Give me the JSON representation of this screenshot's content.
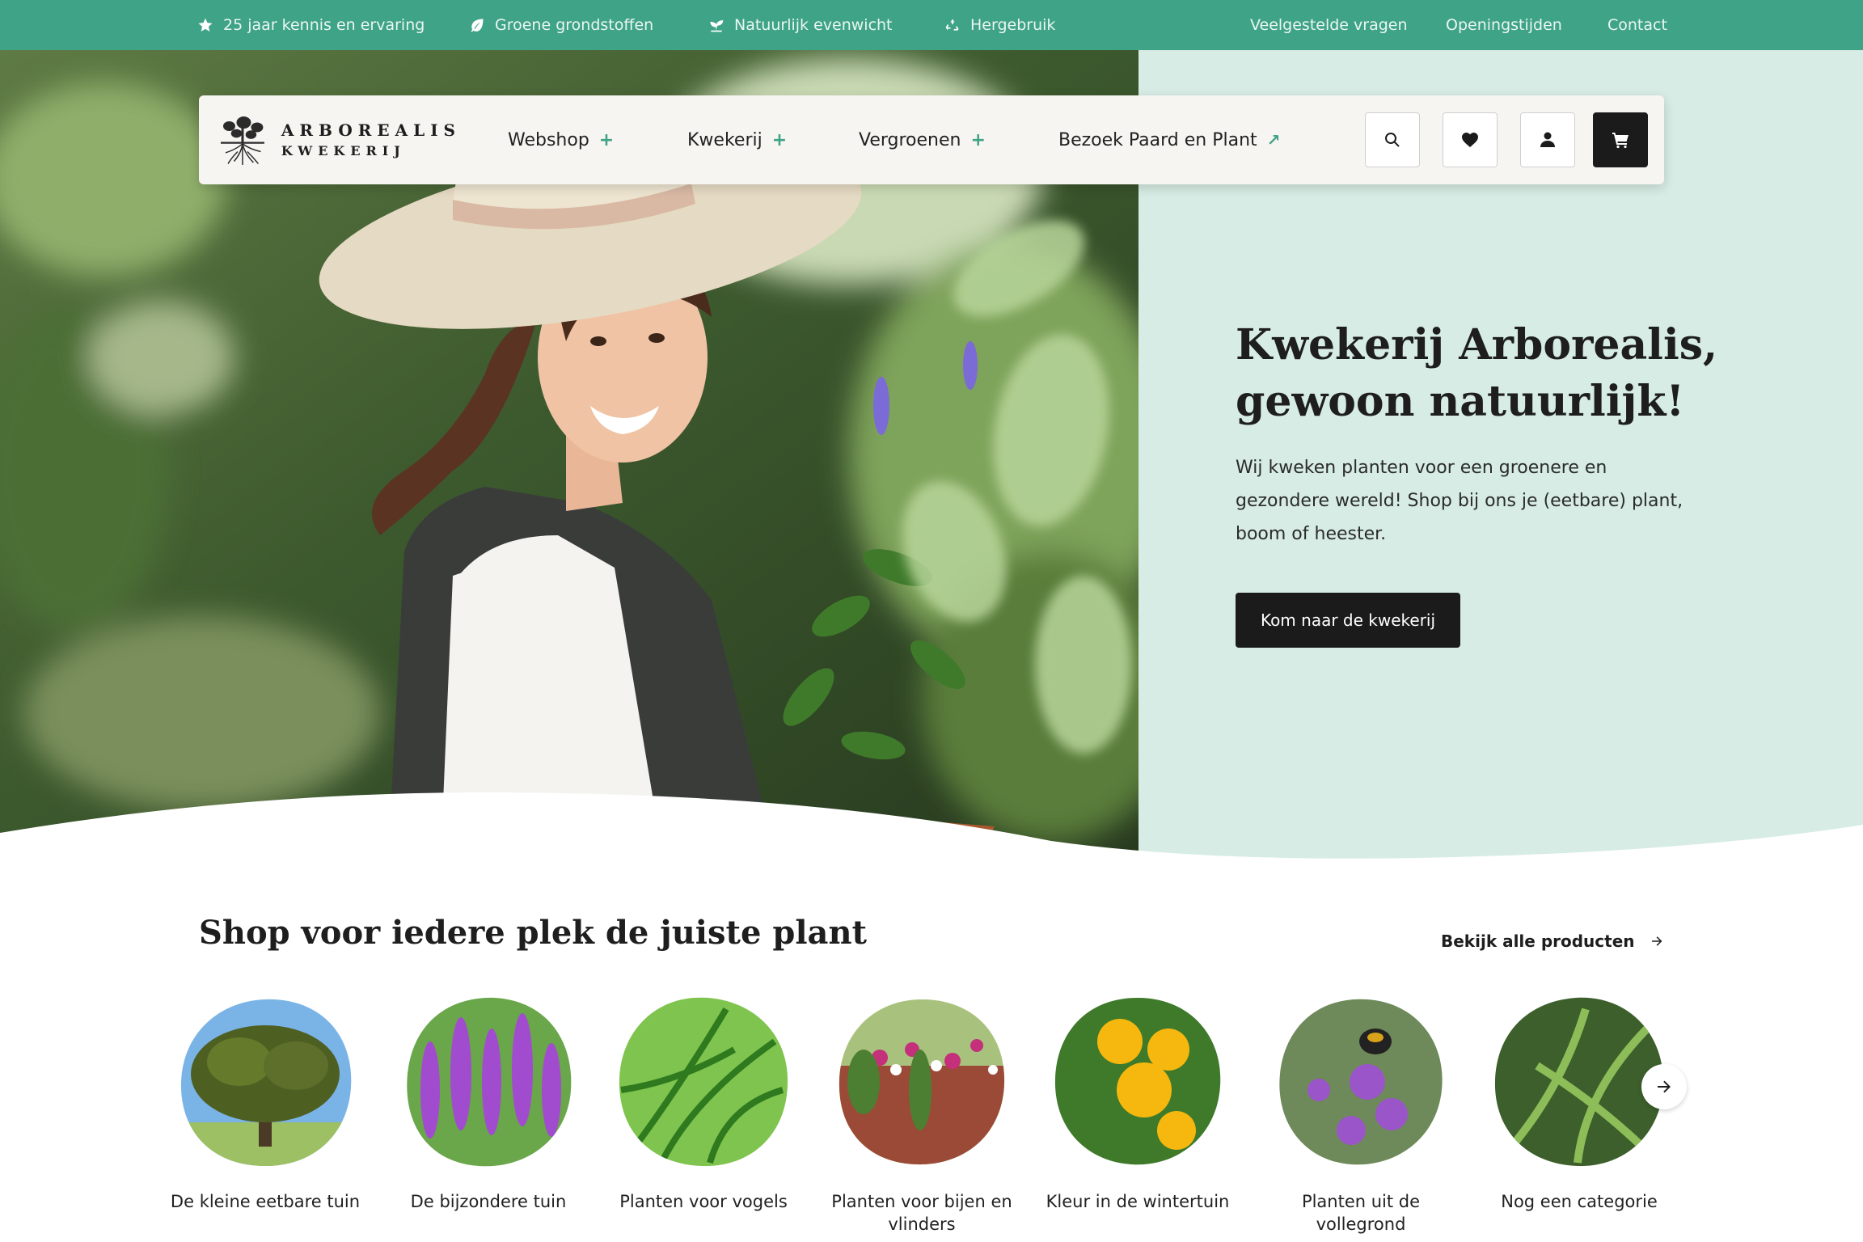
{
  "topbar": {
    "usps": [
      {
        "icon": "star-icon",
        "label": "25 jaar kennis en ervaring"
      },
      {
        "icon": "leaf-icon",
        "label": "Groene grondstoffen"
      },
      {
        "icon": "sprout-icon",
        "label": "Natuurlijk evenwicht"
      },
      {
        "icon": "recycle-icon",
        "label": "Hergebruik"
      }
    ],
    "links": [
      "Veelgestelde vragen",
      "Openingstijden",
      "Contact"
    ]
  },
  "logo": {
    "line1": "ARBOREALIS",
    "line2": "KWEKERIJ"
  },
  "nav": {
    "items": [
      {
        "label": "Webshop",
        "marker": "+"
      },
      {
        "label": "Kwekerij",
        "marker": "+"
      },
      {
        "label": "Vergroenen",
        "marker": "+"
      },
      {
        "label": "Bezoek Paard en Plant",
        "marker": "↗"
      }
    ],
    "buttons": [
      "search-icon",
      "heart-icon",
      "user-icon",
      "cart-icon"
    ]
  },
  "hero": {
    "title_line1": "Kwekerij Arborealis,",
    "title_line2": "gewoon natuurlijk!",
    "text": "Wij kweken planten voor een groenere en gezondere wereld! Shop bij ons je (eetbare) plant, boom of heester.",
    "cta": "Kom naar de kwekerij"
  },
  "categories_section": {
    "title": "Shop voor iedere plek de juiste plant",
    "all_link": "Bekijk alle producten",
    "items": [
      {
        "label": "De kleine eetbare tuin"
      },
      {
        "label": "De bijzondere tuin"
      },
      {
        "label": "Planten voor vogels"
      },
      {
        "label": "Planten voor bijen en vlinders"
      },
      {
        "label": "Kleur in de wintertuin"
      },
      {
        "label": "Planten uit de vollegrond"
      },
      {
        "label": "Nog een categorie"
      }
    ]
  },
  "colors": {
    "brand_green": "#3fa387",
    "hero_panel": "#d6ece4",
    "dark": "#1b1b1b"
  }
}
